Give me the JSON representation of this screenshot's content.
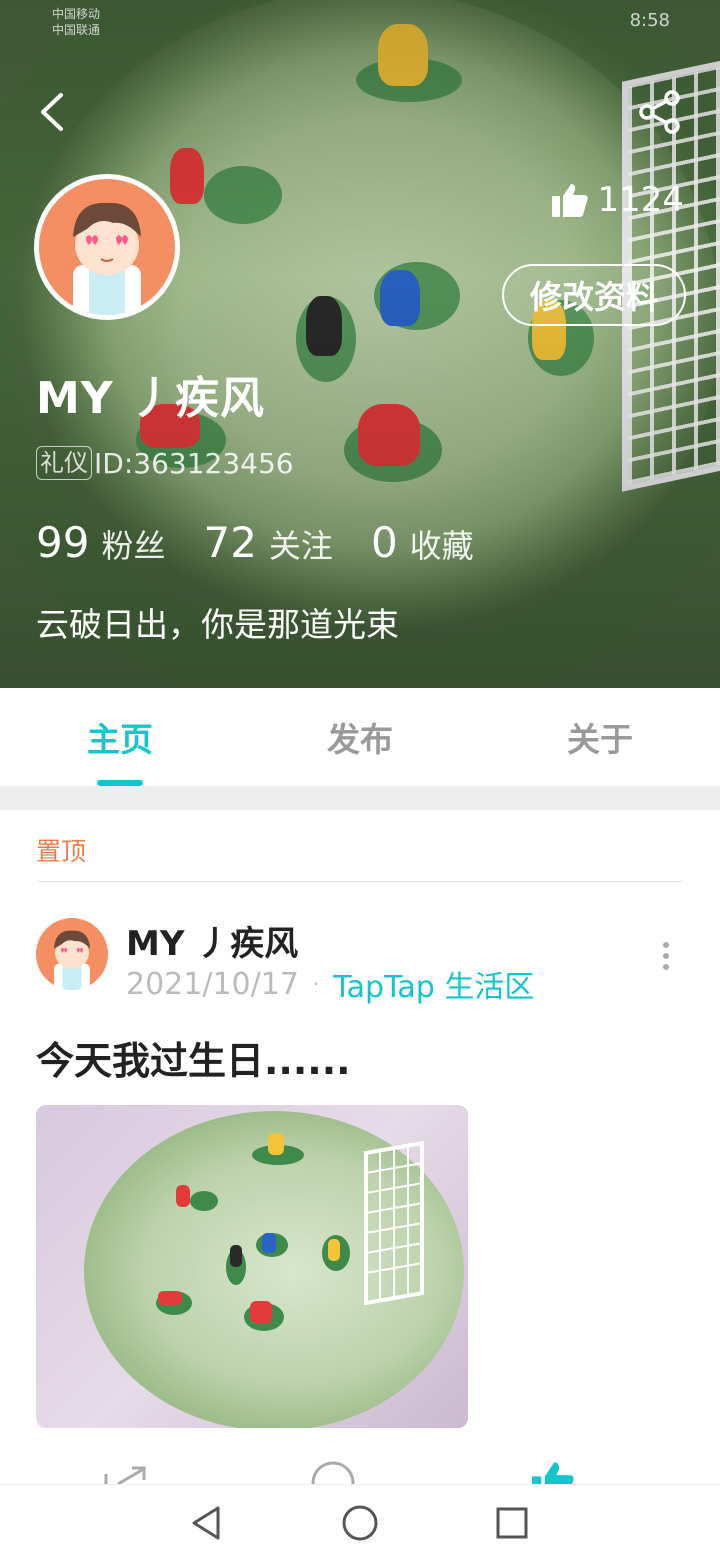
{
  "status_bar": {
    "carrier_1": "中国移动",
    "carrier_2": "中国联通",
    "time": "8:58"
  },
  "profile": {
    "username": "MY 丿疾风",
    "badge": "礼仪",
    "id_text": "ID:363123456",
    "likes": "1124",
    "edit_label": "修改资料",
    "bio": "云破日出，你是那道光束",
    "stats": [
      {
        "num": "99",
        "label": "粉丝"
      },
      {
        "num": "72",
        "label": "关注"
      },
      {
        "num": "0",
        "label": "收藏"
      }
    ]
  },
  "tabs": [
    {
      "label": "主页",
      "active": true
    },
    {
      "label": "发布",
      "active": false
    },
    {
      "label": "关于",
      "active": false
    }
  ],
  "post": {
    "pinned_label": "置顶",
    "author": "MY 丿疾风",
    "date": "2021/10/17",
    "separator": "·",
    "forum": "TapTap 生活区",
    "title": "今天我过生日......"
  },
  "colors": {
    "accent": "#15c5ce",
    "pinned": "#f07a4a",
    "avatar_bg": "#f58f63"
  },
  "icons": {
    "back": "back-arrow-icon",
    "share": "share-icon",
    "like": "thumbs-up-icon",
    "more": "more-vertical-icon",
    "nav_back": "triangle-back-icon",
    "nav_home": "circle-home-icon",
    "nav_recent": "square-recent-icon"
  }
}
